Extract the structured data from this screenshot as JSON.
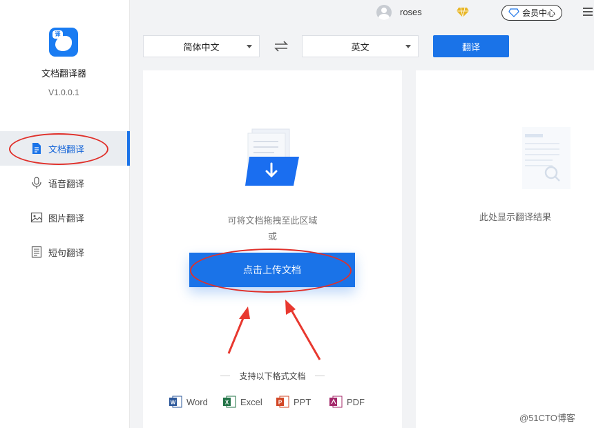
{
  "app": {
    "name": "文档翻译器",
    "version": "V1.0.0.1"
  },
  "sidebar": {
    "items": [
      {
        "label": "文档翻译",
        "icon": "document-icon",
        "active": true
      },
      {
        "label": "语音翻译",
        "icon": "microphone-icon",
        "active": false
      },
      {
        "label": "图片翻译",
        "icon": "image-icon",
        "active": false
      },
      {
        "label": "短句翻译",
        "icon": "sentence-icon",
        "active": false
      }
    ]
  },
  "header": {
    "username": "roses",
    "member_center_label": "会员中心"
  },
  "toolbar": {
    "source_language": "简体中文",
    "target_language": "英文",
    "translate_label": "翻译"
  },
  "upload": {
    "drop_hint": "可将文档拖拽至此区域",
    "or_text": "或",
    "upload_button_label": "点击上传文档",
    "supported_title": "支持以下格式文档",
    "formats": [
      {
        "label": "Word",
        "color": "#2b579a"
      },
      {
        "label": "Excel",
        "color": "#217346"
      },
      {
        "label": "PPT",
        "color": "#d24726"
      },
      {
        "label": "PDF",
        "color": "#a4286a"
      }
    ]
  },
  "result": {
    "placeholder": "此处显示翻译结果"
  },
  "watermark": "@51CTO博客",
  "colors": {
    "accent": "#1a73e8",
    "annotation": "#e0302a"
  }
}
